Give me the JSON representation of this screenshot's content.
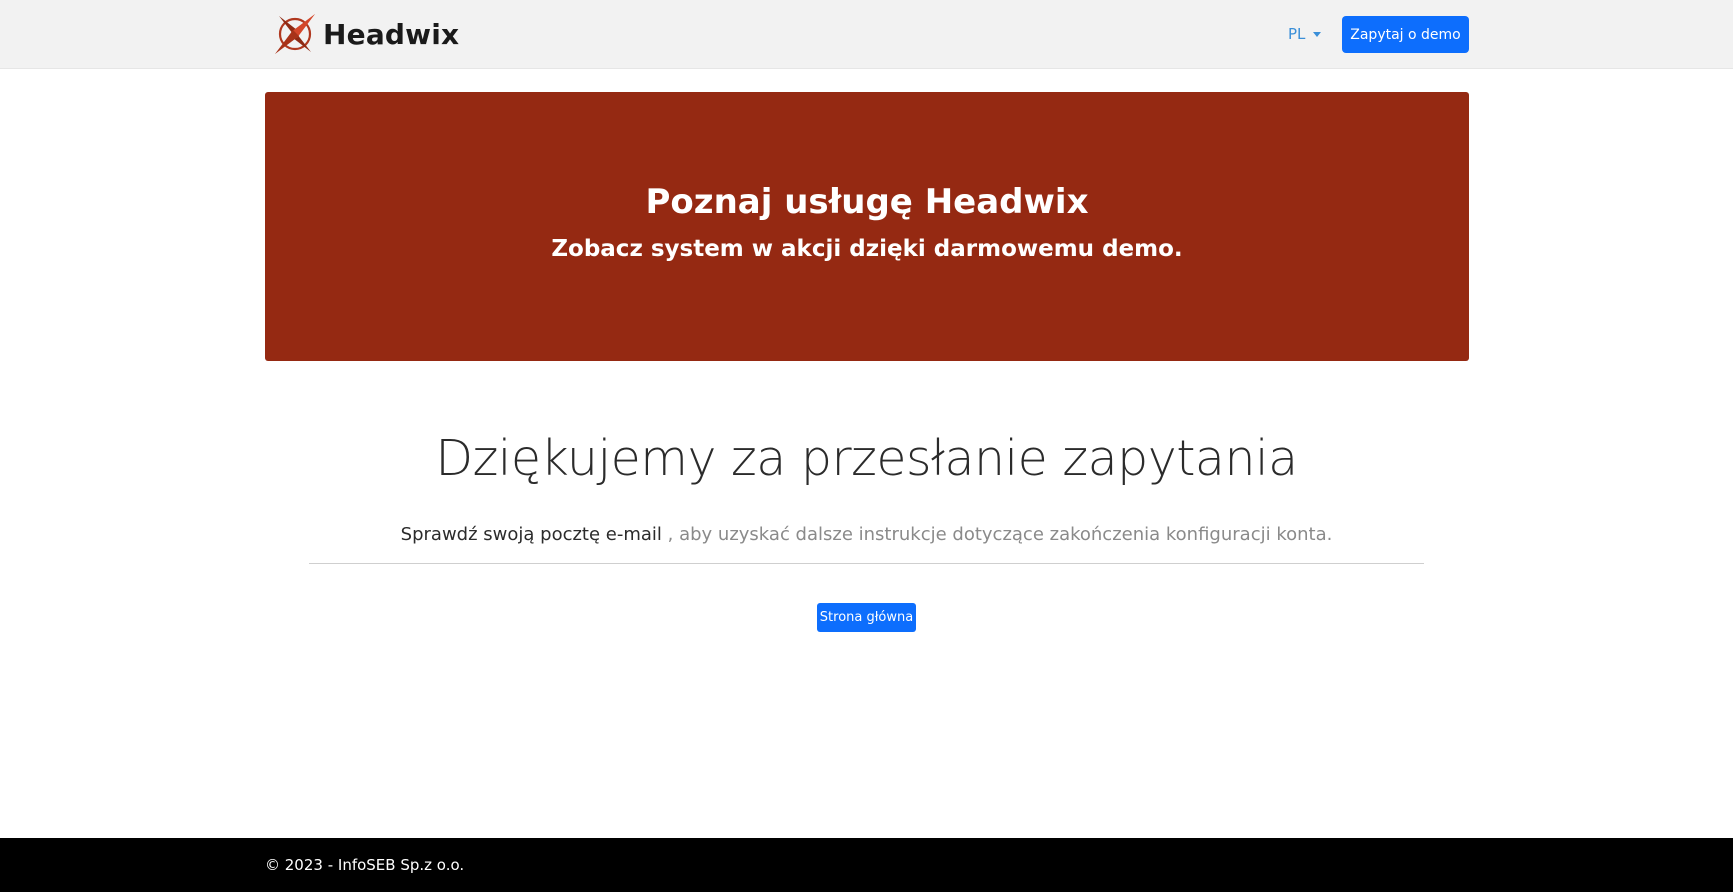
{
  "header": {
    "brand_name": "Headwix",
    "logo_icon": "compass-star-icon",
    "language": "PL",
    "demo_button_label": "Zapytaj o demo"
  },
  "hero": {
    "title": "Poznaj usługę Headwix",
    "subtitle": "Zobacz system w akcji dzięki darmowemu demo.",
    "background_color": "#952912"
  },
  "main": {
    "title": "Dziękujemy za przesłanie zapytania",
    "lead_strong": "Sprawdź swoją pocztę e-mail",
    "lead_rest": " , aby uzyskać dalsze instrukcje dotyczące zakończenia konfiguracji konta.",
    "home_button_label": "Strona główna"
  },
  "footer": {
    "copyright": "© 2023 - InfoSEB Sp.z o.o."
  },
  "colors": {
    "accent": "#0d6efd",
    "brand": "#952912",
    "footer": "#000000"
  }
}
